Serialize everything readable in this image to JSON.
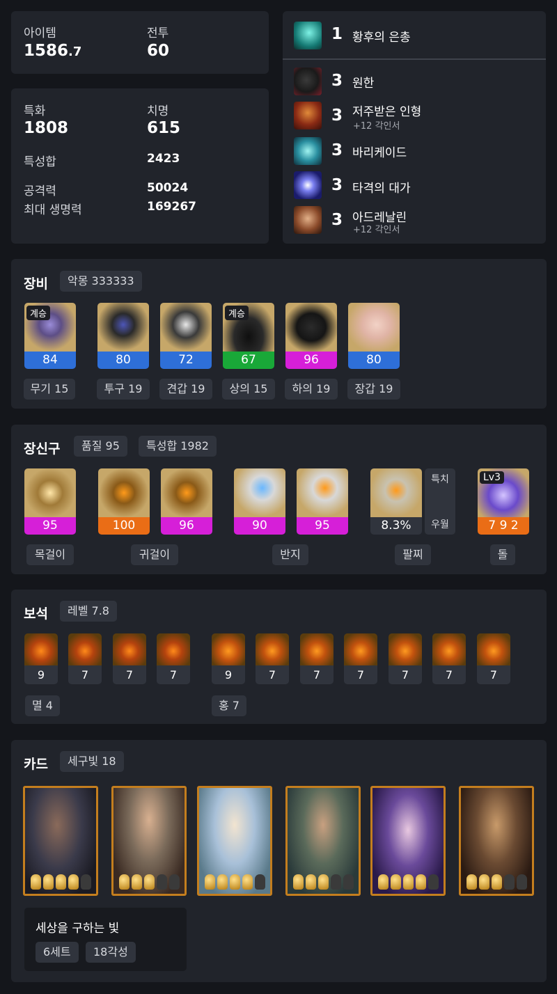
{
  "stats": {
    "item_label": "아이템",
    "item_value": "1586",
    "item_decimal": ".7",
    "combat_label": "전투",
    "combat_value": "60",
    "spec_label": "특화",
    "spec_value": "1808",
    "crit_label": "치명",
    "crit_value": "615",
    "stat_sum_label": "특성합",
    "stat_sum_value": "2423",
    "attack_label": "공격력",
    "attack_value": "50024",
    "hp_label": "최대 생명력",
    "hp_value": "169267"
  },
  "engravings": [
    {
      "level": "1",
      "name": "황후의 은총",
      "sub": "",
      "icon": "empress-grace-icon",
      "color": "#1fa8a0"
    },
    {
      "level": "3",
      "name": "원한",
      "sub": "",
      "icon": "grudge-icon",
      "color": "#7a1f2a"
    },
    {
      "level": "3",
      "name": "저주받은 인형",
      "sub": "+12 각인서",
      "icon": "cursed-doll-icon",
      "color": "#b8501e"
    },
    {
      "level": "3",
      "name": "바리케이드",
      "sub": "",
      "icon": "barricade-icon",
      "color": "#2a8fa0"
    },
    {
      "level": "3",
      "name": "타격의 대가",
      "sub": "",
      "icon": "hit-master-icon",
      "color": "#3a3fd0"
    },
    {
      "level": "3",
      "name": "아드레날린",
      "sub": "+12 각인서",
      "icon": "adrenaline-icon",
      "color": "#8a4a2a"
    }
  ],
  "equipment": {
    "title": "장비",
    "badge": "악몽 333333",
    "items": [
      {
        "quality": "84",
        "tag": "계승",
        "label": "무기 15",
        "icon": "weapon-icon",
        "color": "#2e6fd8"
      },
      {
        "quality": "80",
        "tag": "",
        "label": "투구 19",
        "icon": "helmet-icon",
        "color": "#2e6fd8"
      },
      {
        "quality": "72",
        "tag": "",
        "label": "견갑 19",
        "icon": "shoulder-icon",
        "color": "#2e6fd8"
      },
      {
        "quality": "67",
        "tag": "계승",
        "label": "상의 15",
        "icon": "chest-icon",
        "color": "#19a838"
      },
      {
        "quality": "96",
        "tag": "",
        "label": "하의 19",
        "icon": "pants-icon",
        "color": "#d61fd8"
      },
      {
        "quality": "80",
        "tag": "",
        "label": "장갑 19",
        "icon": "gloves-icon",
        "color": "#2e6fd8"
      }
    ]
  },
  "accessories": {
    "title": "장신구",
    "quality_badge": "품질 95",
    "stat_badge": "특성합 1982",
    "items": [
      {
        "quality": "95",
        "icon": "necklace-icon",
        "color": "#d61fd8"
      },
      {
        "quality": "100",
        "icon": "earring-icon",
        "color": "#ea6d16"
      },
      {
        "quality": "96",
        "icon": "earring-icon",
        "color": "#d61fd8"
      },
      {
        "quality": "90",
        "icon": "ring-icon",
        "color": "#d61fd8"
      },
      {
        "quality": "95",
        "icon": "ring-icon",
        "color": "#d61fd8"
      }
    ],
    "bracelet": {
      "value": "8.3%",
      "stat1": "특치",
      "stat2": "우월",
      "icon": "bracelet-icon"
    },
    "stone": {
      "tag": "Lv3",
      "value": "7 9 2",
      "icon": "ability-stone-icon",
      "color": "#ea6d16"
    },
    "labels": {
      "necklace": "목걸이",
      "earring": "귀걸이",
      "ring": "반지",
      "bracelet": "팔찌",
      "stone": "돌"
    }
  },
  "gems": {
    "title": "보석",
    "badge": "레벨 7.8",
    "annihilation": [
      "9",
      "7",
      "7",
      "7"
    ],
    "crimson": [
      "9",
      "7",
      "7",
      "7",
      "7",
      "7",
      "7"
    ],
    "annihilation_label": "멸 4",
    "crimson_label": "홍 7"
  },
  "cards": {
    "title": "카드",
    "badge": "세구빛 18",
    "items": [
      {
        "awaken": 4,
        "icon": "card-portrait-1"
      },
      {
        "awaken": 3,
        "icon": "card-portrait-2"
      },
      {
        "awaken": 4,
        "icon": "card-portrait-3"
      },
      {
        "awaken": 3,
        "icon": "card-portrait-4"
      },
      {
        "awaken": 4,
        "icon": "card-portrait-5"
      },
      {
        "awaken": 3,
        "icon": "card-portrait-6"
      }
    ],
    "set_name": "세상을 구하는 빛",
    "set_count": "6세트",
    "set_awaken": "18각성"
  },
  "colors": {
    "blue": "#2e6fd8",
    "green": "#19a838",
    "magenta": "#d61fd8",
    "orange": "#ea6d16",
    "card_border": "#c47e1e"
  }
}
